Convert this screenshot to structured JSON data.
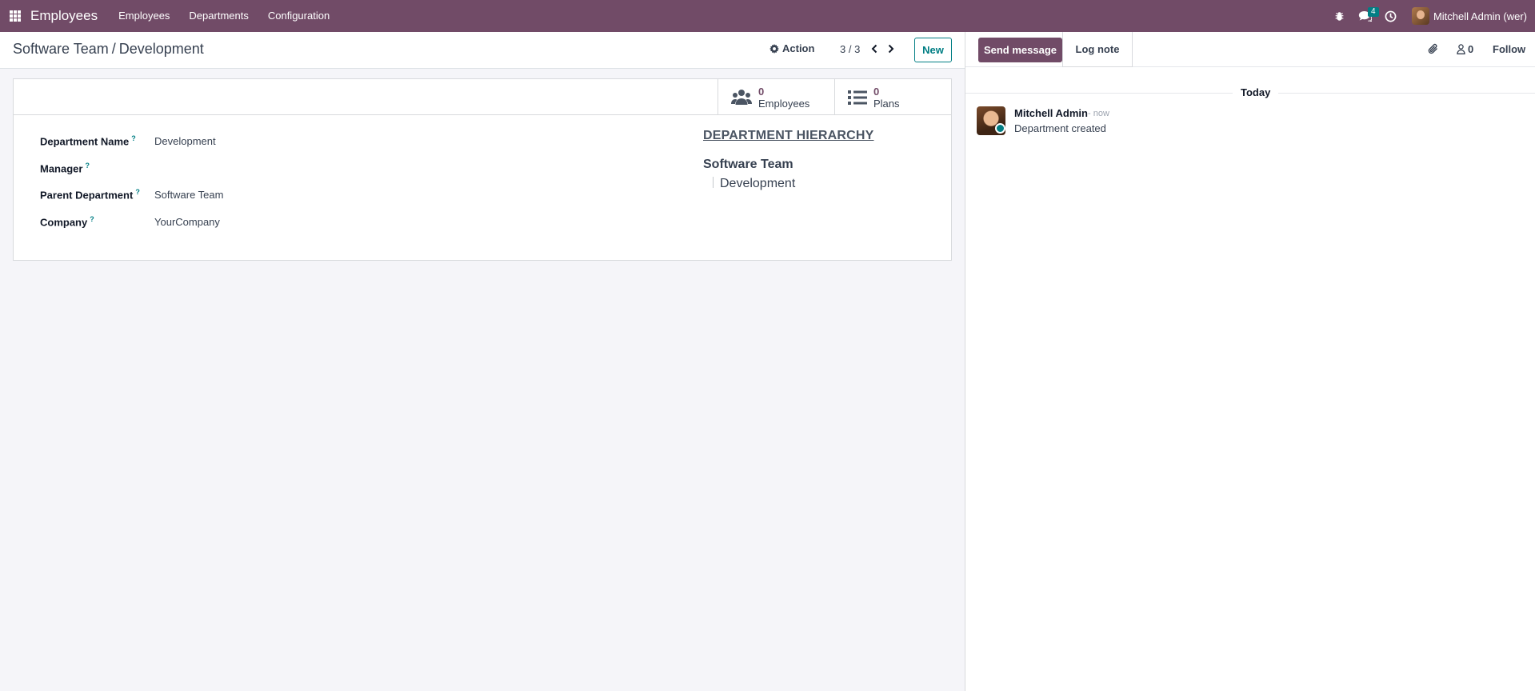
{
  "navbar": {
    "app_name": "Employees",
    "menu": [
      "Employees",
      "Departments",
      "Configuration"
    ],
    "messages_badge": "4",
    "user_name": "Mitchell Admin (wer)"
  },
  "control": {
    "breadcrumb_parent": "Software Team",
    "breadcrumb_sep": "/",
    "breadcrumb_current": "Development",
    "action_label": "Action",
    "pager": "3 / 3",
    "new_label": "New"
  },
  "stats": {
    "employees_count": "0",
    "employees_label": "Employees",
    "plans_count": "0",
    "plans_label": "Plans"
  },
  "form": {
    "fields": [
      {
        "label": "Department Name",
        "value": "Development"
      },
      {
        "label": "Manager",
        "value": ""
      },
      {
        "label": "Parent Department",
        "value": "Software Team"
      },
      {
        "label": "Company",
        "value": "YourCompany"
      }
    ],
    "help_mark": "?"
  },
  "hierarchy": {
    "title": "DEPARTMENT HIERARCHY",
    "parent": "Software Team",
    "child": "Development"
  },
  "chatter": {
    "send_message": "Send message",
    "log_note": "Log note",
    "followers": "0",
    "follow": "Follow",
    "date_separator": "Today",
    "message": {
      "author": "Mitchell Admin",
      "time": "- now",
      "body": "Department created"
    }
  },
  "colors": {
    "brand": "#714b67",
    "accent": "#017e84"
  }
}
